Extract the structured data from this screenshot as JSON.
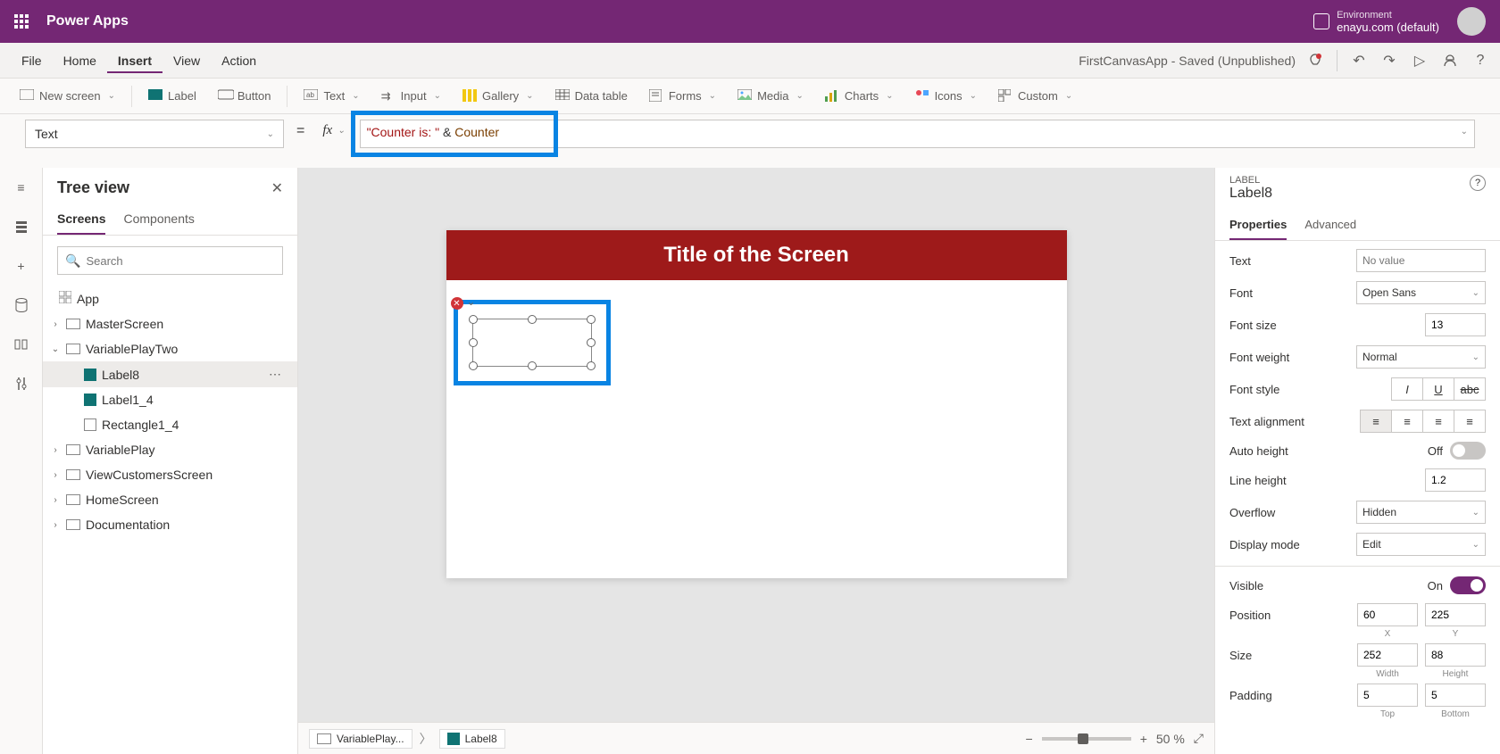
{
  "header": {
    "app_name": "Power Apps",
    "env_label": "Environment",
    "env_value": "enayu.com (default)"
  },
  "menu": {
    "items": [
      "File",
      "Home",
      "Insert",
      "View",
      "Action"
    ],
    "active": "Insert",
    "doc_title": "FirstCanvasApp - Saved (Unpublished)"
  },
  "ribbon": {
    "new_screen": "New screen",
    "label": "Label",
    "button": "Button",
    "text": "Text",
    "input": "Input",
    "gallery": "Gallery",
    "data_table": "Data table",
    "forms": "Forms",
    "media": "Media",
    "charts": "Charts",
    "icons": "Icons",
    "custom": "Custom"
  },
  "formula": {
    "property": "Text",
    "raw": "\"Counter is: \" & Counter",
    "str_part": "\"Counter is: \"",
    "amp": " & ",
    "var_part": "Counter"
  },
  "tree": {
    "title": "Tree view",
    "tabs": {
      "screens": "Screens",
      "components": "Components"
    },
    "search_placeholder": "Search",
    "app": "App",
    "items": [
      {
        "name": "MasterScreen",
        "expanded": false,
        "children": []
      },
      {
        "name": "VariablePlayTwo",
        "expanded": true,
        "children": [
          {
            "name": "Label8",
            "type": "label",
            "selected": true
          },
          {
            "name": "Label1_4",
            "type": "label"
          },
          {
            "name": "Rectangle1_4",
            "type": "rect"
          }
        ]
      },
      {
        "name": "VariablePlay",
        "expanded": false
      },
      {
        "name": "ViewCustomersScreen",
        "expanded": false
      },
      {
        "name": "HomeScreen",
        "expanded": false
      },
      {
        "name": "Documentation",
        "expanded": false
      }
    ]
  },
  "canvas": {
    "screen_title": "Title of the Screen",
    "breadcrumb": [
      "VariablePlay...",
      "Label8"
    ],
    "zoom": "50 %"
  },
  "props": {
    "type_label": "LABEL",
    "name": "Label8",
    "tabs": {
      "properties": "Properties",
      "advanced": "Advanced"
    },
    "text_label": "Text",
    "text_placeholder": "No value",
    "font_label": "Font",
    "font_value": "Open Sans",
    "fontsize_label": "Font size",
    "fontsize_value": "13",
    "fontweight_label": "Font weight",
    "fontweight_value": "Normal",
    "fontstyle_label": "Font style",
    "textalign_label": "Text alignment",
    "autoheight_label": "Auto height",
    "autoheight_value": "Off",
    "lineheight_label": "Line height",
    "lineheight_value": "1.2",
    "overflow_label": "Overflow",
    "overflow_value": "Hidden",
    "displaymode_label": "Display mode",
    "displaymode_value": "Edit",
    "visible_label": "Visible",
    "visible_value": "On",
    "position_label": "Position",
    "position_x": "60",
    "position_y": "225",
    "position_xlabel": "X",
    "position_ylabel": "Y",
    "size_label": "Size",
    "size_w": "252",
    "size_h": "88",
    "size_wlabel": "Width",
    "size_hlabel": "Height",
    "padding_label": "Padding",
    "padding_t": "5",
    "padding_b": "5",
    "padding_tlabel": "Top",
    "padding_blabel": "Bottom"
  }
}
